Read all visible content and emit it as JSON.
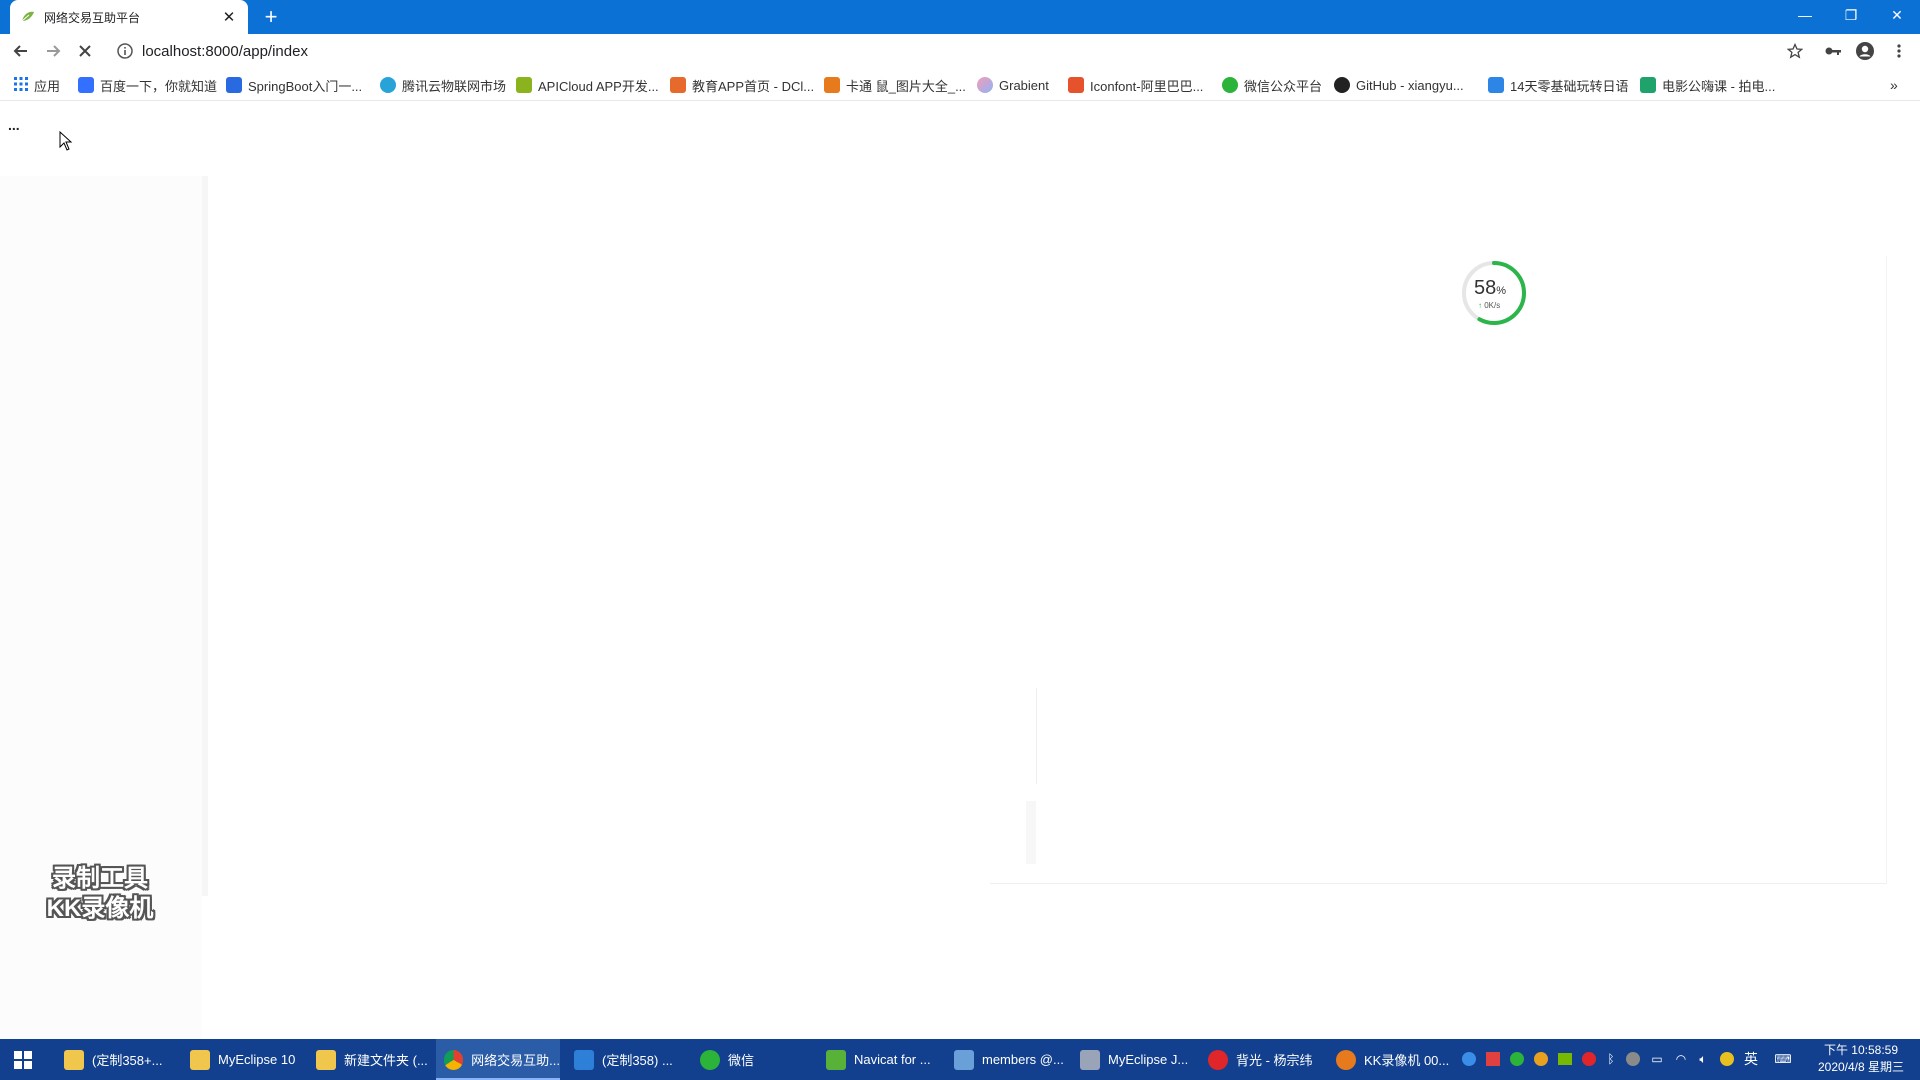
{
  "browser": {
    "tab_title": "网络交易互助平台",
    "url": "localhost:8000/app/index",
    "bookmarks": [
      {
        "label": "应用",
        "color": "#1a73e8"
      },
      {
        "label": "百度一下，你就知道",
        "color": "#3370ff"
      },
      {
        "label": "SpringBoot入门一...",
        "color": "#2a6ae0"
      },
      {
        "label": "腾讯云物联网市场",
        "color": "#27a3d8"
      },
      {
        "label": "APICloud APP开发...",
        "color": "#8bb31e"
      },
      {
        "label": "教育APP首页 - DCl...",
        "color": "#e56a2c"
      },
      {
        "label": "卡通 鼠_图片大全_...",
        "color": "#e87a1e"
      },
      {
        "label": "Grabient",
        "color": "#b48df0"
      },
      {
        "label": "Iconfont-阿里巴巴...",
        "color": "#e5522c"
      },
      {
        "label": "微信公众平台",
        "color": "#2bb33a"
      },
      {
        "label": "GitHub - xiangyu...",
        "color": "#222222"
      },
      {
        "label": "14天零基础玩转日语",
        "color": "#2d86e6"
      },
      {
        "label": "电影公嗨课 - 拍电...",
        "color": "#1fa36a"
      }
    ],
    "bookmarks_more": "»"
  },
  "page": {
    "loading_dots": "...",
    "speed_meter": {
      "percent": "58",
      "percent_sign": "%",
      "rate": "0K/s",
      "progress": 0.58,
      "color": "#2bb54a"
    }
  },
  "watermark": {
    "line1": "录制工具",
    "line2": "KK录像机"
  },
  "taskbar": {
    "items": [
      {
        "label": "(定制358+...",
        "color": "#f0c64c"
      },
      {
        "label": "MyEclipse 10",
        "color": "#f0c64c"
      },
      {
        "label": "新建文件夹 (...",
        "color": "#f0c64c"
      },
      {
        "label": "网络交易互助...",
        "color": "#e0422f",
        "active": true
      },
      {
        "label": "(定制358) ...",
        "color": "#2d7fd8"
      },
      {
        "label": "微信",
        "color": "#2bb33a"
      },
      {
        "label": "Navicat for ...",
        "color": "#58b23a"
      },
      {
        "label": "members @...",
        "color": "#6aa0d8"
      },
      {
        "label": "MyEclipse J...",
        "color": "#9aa4b8"
      },
      {
        "label": "背光 - 杨宗纬",
        "color": "#e0262a"
      },
      {
        "label": "KK录像机 00...",
        "color": "#e87a1e"
      }
    ],
    "tray_lang": "英",
    "clock_time": "下午 10:58:59",
    "clock_date": "2020/4/8 星期三"
  }
}
